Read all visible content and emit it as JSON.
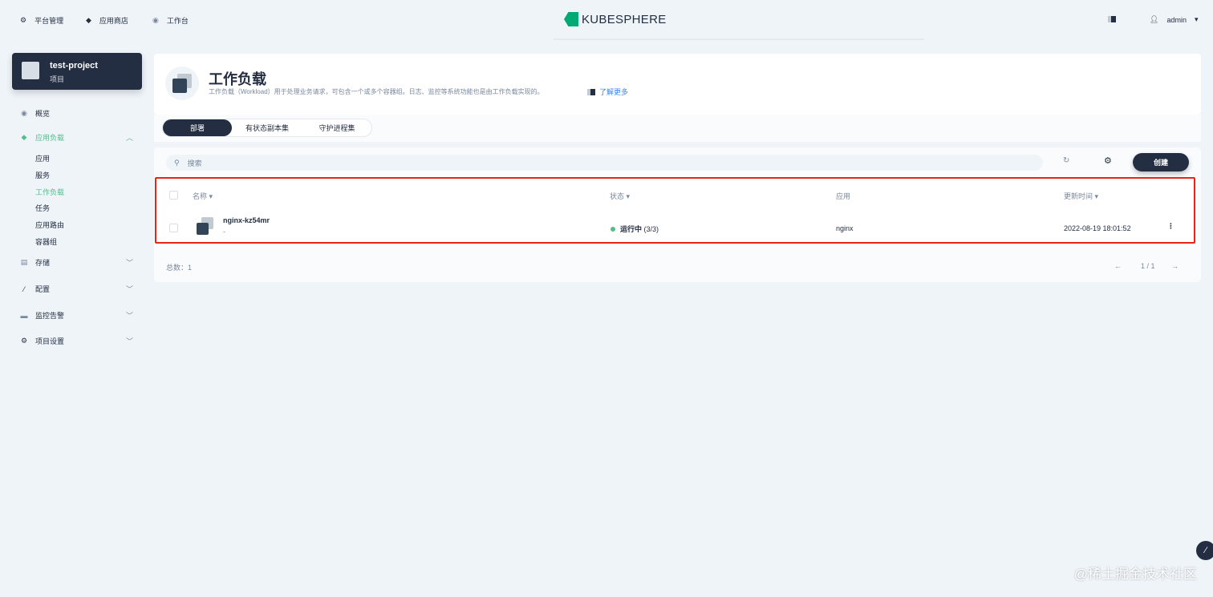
{
  "topnav": {
    "items": [
      {
        "icon": "gear-icon",
        "label": "平台管理"
      },
      {
        "icon": "layers-icon",
        "label": "应用商店"
      },
      {
        "icon": "dashboard-icon",
        "label": "工作台"
      }
    ],
    "logo": "KUBESPHERE",
    "user": "admin"
  },
  "project": {
    "name": "test-project",
    "type": "项目"
  },
  "sidebar": {
    "items": [
      {
        "label": "概览"
      },
      {
        "label": "应用负载"
      },
      {
        "label": "存储"
      },
      {
        "label": "配置"
      },
      {
        "label": "监控告警"
      },
      {
        "label": "项目设置"
      }
    ],
    "sub_items": [
      {
        "label": "应用"
      },
      {
        "label": "服务"
      },
      {
        "label": "工作负载"
      },
      {
        "label": "任务"
      },
      {
        "label": "应用路由"
      },
      {
        "label": "容器组"
      }
    ]
  },
  "header": {
    "title": "工作负载",
    "description": "工作负载（Workload）用于处理业务请求，可包含一个或多个容器组。日志、监控等系统功能也是由工作负载实现的。",
    "learn_more": "了解更多"
  },
  "tabs": [
    {
      "label": "部署"
    },
    {
      "label": "有状态副本集"
    },
    {
      "label": "守护进程集"
    }
  ],
  "toolbar": {
    "search_placeholder": "搜索",
    "create_label": "创建"
  },
  "table": {
    "columns": [
      "名称",
      "状态",
      "应用",
      "更新时间"
    ],
    "rows": [
      {
        "name": "nginx-kz54mr",
        "desc": "-",
        "status": "运行中",
        "replicas": "(3/3)",
        "app": "nginx",
        "updated": "2022-08-19 18:01:52"
      }
    ]
  },
  "footer": {
    "total": "总数：1",
    "page": "1 / 1"
  },
  "colors": {
    "accent": "#55bc8a",
    "dark": "#242e42",
    "highlight": "#e8231a"
  },
  "watermark": "@稀土掘金技术社区"
}
